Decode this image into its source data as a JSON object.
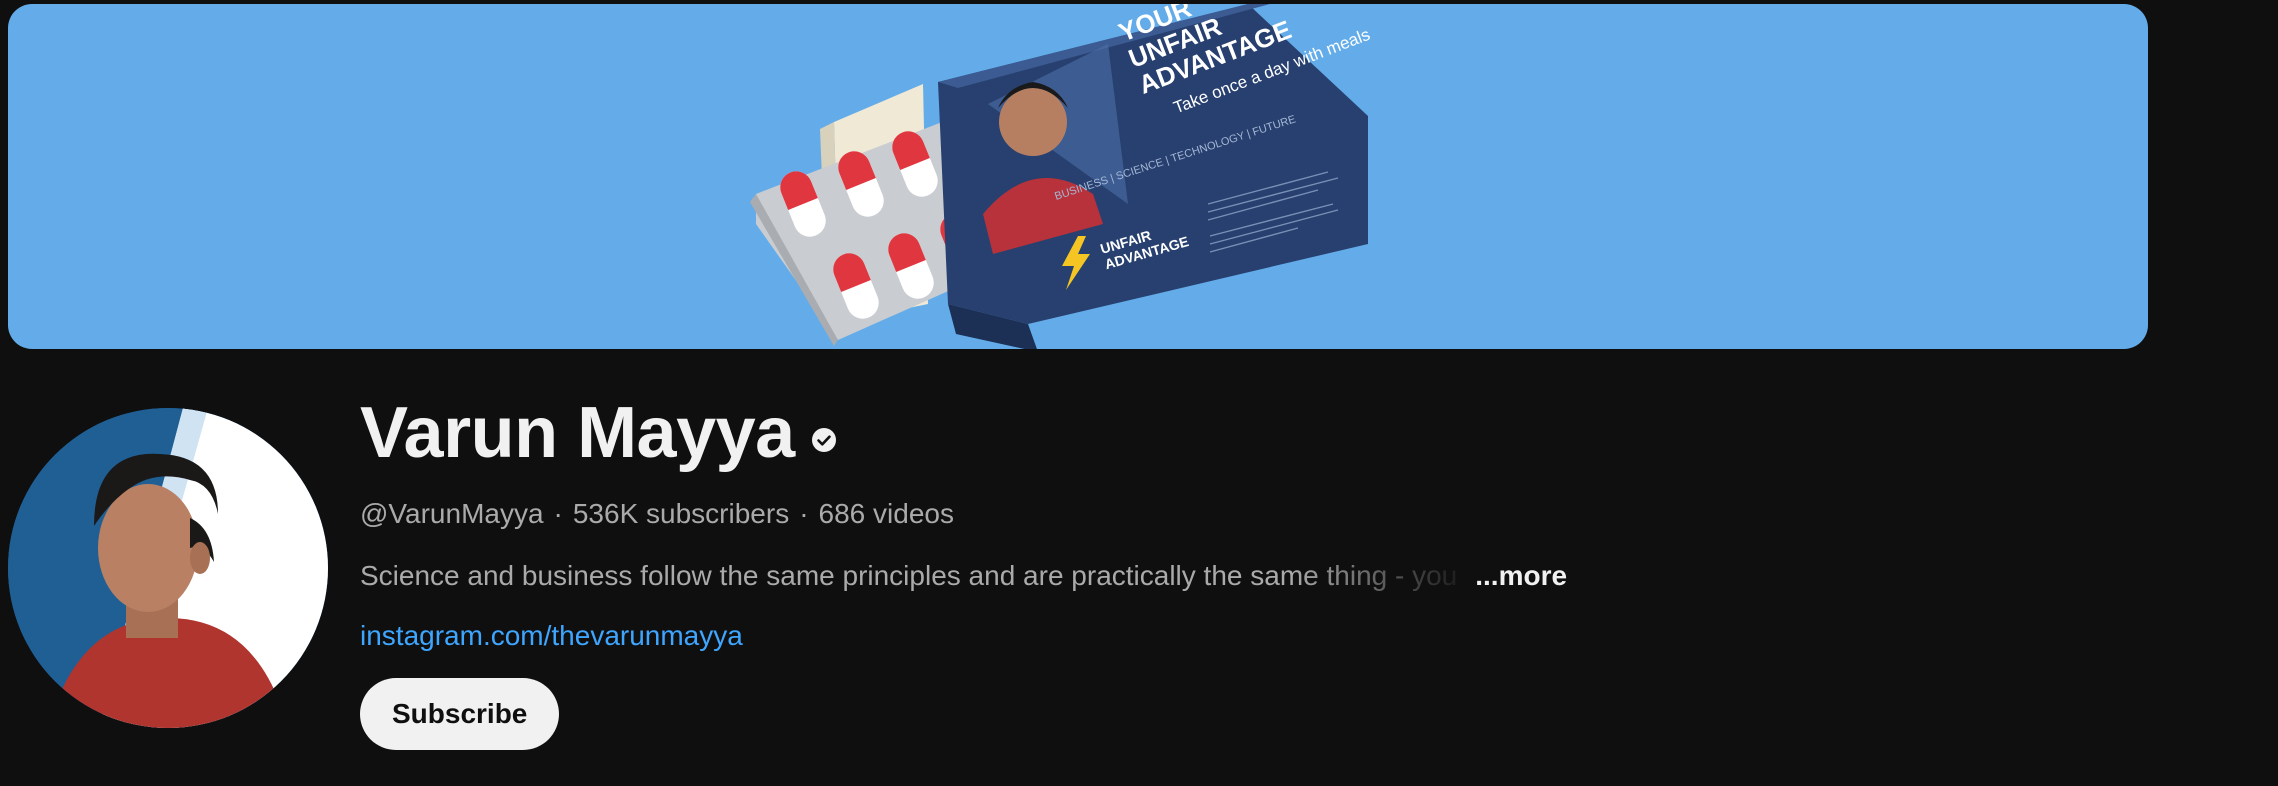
{
  "channel": {
    "name": "Varun Mayya",
    "handle": "@VarunMayya",
    "subscribers": "536K subscribers",
    "videos": "686 videos",
    "meta_separator": "·",
    "description": "Science and business follow the same principles and are practically the same thing - you",
    "more_label": "...more",
    "link_text": "instagram.com/thevarunmayya",
    "subscribe_label": "Subscribe",
    "verified_icon": "verified-check-icon"
  },
  "banner": {
    "background_color": "#63ace9",
    "box_headline": "YOUR UNFAIR ADVANTAGE",
    "box_tagline": "Take once a day with meals",
    "box_topics": "BUSINESS | SCIENCE | TECHNOLOGY | FUTURE",
    "box_brand": "UNFAIR ADVANTAGE"
  },
  "colors": {
    "page_background": "#0f0f0f",
    "primary_text": "#f1f1f1",
    "secondary_text": "#aaaaaa",
    "link": "#3ea6ff",
    "subscribe_bg": "#f1f1f1"
  }
}
